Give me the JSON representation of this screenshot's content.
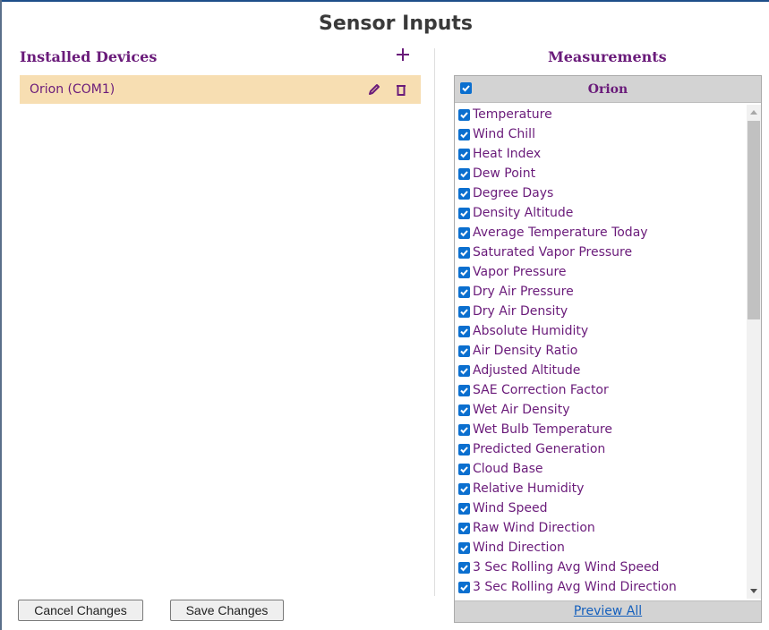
{
  "dialog": {
    "title": "Sensor Inputs"
  },
  "installed_devices": {
    "title": "Installed Devices",
    "add_icon": "plus-icon",
    "devices": [
      {
        "label": "Orion (COM1)",
        "edit_icon": "pencil-icon",
        "delete_icon": "trash-icon"
      }
    ]
  },
  "measurements": {
    "title": "Measurements",
    "device_header": "Orion",
    "header_checked": true,
    "items": [
      {
        "label": "Temperature",
        "checked": true
      },
      {
        "label": "Wind Chill",
        "checked": true
      },
      {
        "label": "Heat Index",
        "checked": true
      },
      {
        "label": "Dew Point",
        "checked": true
      },
      {
        "label": "Degree Days",
        "checked": true
      },
      {
        "label": "Density Altitude",
        "checked": true
      },
      {
        "label": "Average Temperature Today",
        "checked": true
      },
      {
        "label": "Saturated Vapor Pressure",
        "checked": true
      },
      {
        "label": "Vapor Pressure",
        "checked": true
      },
      {
        "label": "Dry Air Pressure",
        "checked": true
      },
      {
        "label": "Dry Air Density",
        "checked": true
      },
      {
        "label": "Absolute Humidity",
        "checked": true
      },
      {
        "label": "Air Density Ratio",
        "checked": true
      },
      {
        "label": "Adjusted Altitude",
        "checked": true
      },
      {
        "label": "SAE Correction Factor",
        "checked": true
      },
      {
        "label": "Wet Air Density",
        "checked": true
      },
      {
        "label": "Wet Bulb Temperature",
        "checked": true
      },
      {
        "label": "Predicted Generation",
        "checked": true
      },
      {
        "label": "Cloud Base",
        "checked": true
      },
      {
        "label": "Relative Humidity",
        "checked": true
      },
      {
        "label": "Wind Speed",
        "checked": true
      },
      {
        "label": "Raw Wind Direction",
        "checked": true
      },
      {
        "label": "Wind Direction",
        "checked": true
      },
      {
        "label": "3 Sec Rolling Avg Wind Speed",
        "checked": true
      },
      {
        "label": "3 Sec Rolling Avg Wind Direction",
        "checked": true
      }
    ],
    "preview_label": "Preview All"
  },
  "footer": {
    "cancel_label": "Cancel Changes",
    "save_label": "Save Changes"
  },
  "colors": {
    "accent_purple": "#6a1b7a",
    "selected_row": "#f7deb2",
    "checkbox_blue": "#0b6fcf",
    "link_blue": "#1560bd"
  }
}
